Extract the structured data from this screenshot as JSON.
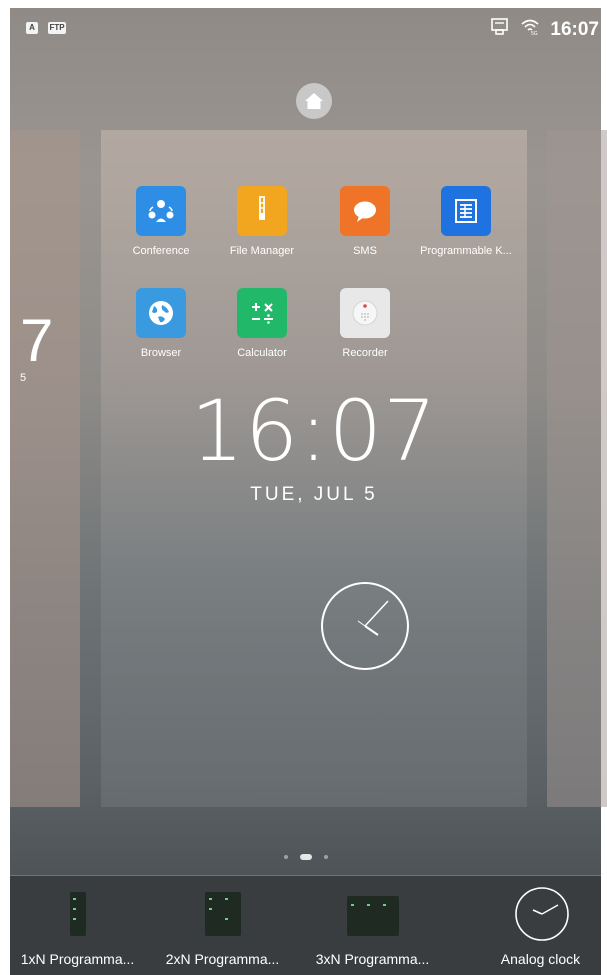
{
  "statusbar": {
    "badges": [
      "A",
      "FTP"
    ],
    "time": "16:07",
    "icons": [
      "ethernet-icon",
      "wifi-icon"
    ]
  },
  "screens": {
    "left": {
      "clock": "7",
      "date": "5"
    },
    "center": {
      "apps": [
        {
          "label": "Conference",
          "icon": "conference-icon",
          "color": "#2e8ee6"
        },
        {
          "label": "File Manager",
          "icon": "file-manager-icon",
          "color": "#f2a51f"
        },
        {
          "label": "SMS",
          "icon": "sms-icon",
          "color": "#f07428"
        },
        {
          "label": "Programmable K...",
          "icon": "programmable-keys-icon",
          "color": "#1e73e0"
        },
        {
          "label": "Browser",
          "icon": "browser-icon",
          "color": "#3a9ae0"
        },
        {
          "label": "Calculator",
          "icon": "calculator-icon",
          "color": "#22b86a"
        },
        {
          "label": "Recorder",
          "icon": "recorder-icon",
          "color": "#e8e8e8"
        }
      ],
      "clock": "16:07",
      "date": "TUE, JUL 5"
    }
  },
  "pages": {
    "count": 3,
    "active_index": 1
  },
  "widgets": [
    {
      "label": "1xN Programma..."
    },
    {
      "label": "2xN Programma..."
    },
    {
      "label": "3xN Programma..."
    },
    {
      "label": "Analog clock"
    }
  ]
}
